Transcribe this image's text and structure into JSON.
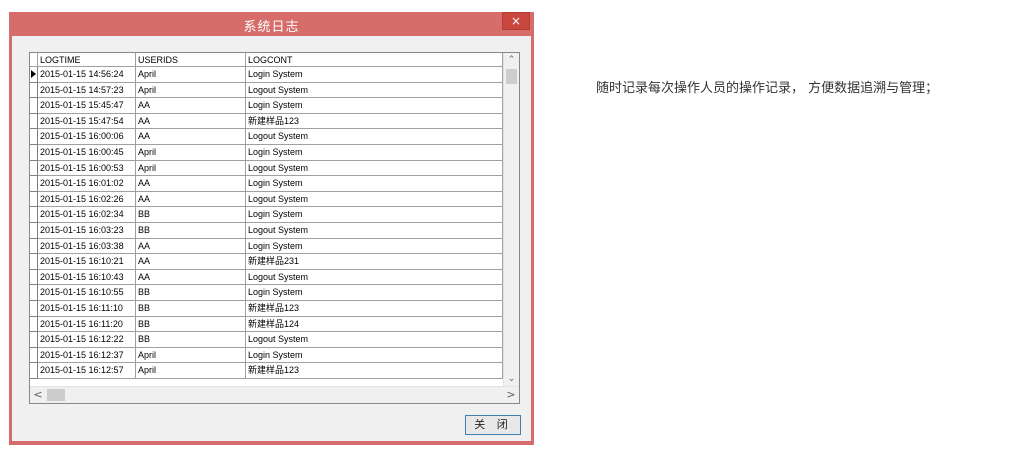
{
  "window": {
    "title": "系统日志",
    "close_glyph": "×",
    "close_button_label": "关 闭"
  },
  "grid": {
    "columns": [
      "LOGTIME",
      "USERIDS",
      "LOGCONT"
    ],
    "rows": [
      [
        "2015-01-15 14:56:24",
        "April",
        "Login System"
      ],
      [
        "2015-01-15 14:57:23",
        "April",
        "Logout System"
      ],
      [
        "2015-01-15 15:45:47",
        "AA",
        "Login System"
      ],
      [
        "2015-01-15 15:47:54",
        "AA",
        "新建样品123"
      ],
      [
        "2015-01-15 16:00:06",
        "AA",
        "Logout System"
      ],
      [
        "2015-01-15 16:00:45",
        "April",
        "Login System"
      ],
      [
        "2015-01-15 16:00:53",
        "April",
        "Logout System"
      ],
      [
        "2015-01-15 16:01:02",
        "AA",
        "Login System"
      ],
      [
        "2015-01-15 16:02:26",
        "AA",
        "Logout System"
      ],
      [
        "2015-01-15 16:02:34",
        "BB",
        "Login System"
      ],
      [
        "2015-01-15 16:03:23",
        "BB",
        "Logout System"
      ],
      [
        "2015-01-15 16:03:38",
        "AA",
        "Login System"
      ],
      [
        "2015-01-15 16:10:21",
        "AA",
        "新建样品231"
      ],
      [
        "2015-01-15 16:10:43",
        "AA",
        "Logout System"
      ],
      [
        "2015-01-15 16:10:55",
        "BB",
        "Login System"
      ],
      [
        "2015-01-15 16:11:10",
        "BB",
        "新建样品123"
      ],
      [
        "2015-01-15 16:11:20",
        "BB",
        "新建样品124"
      ],
      [
        "2015-01-15 16:12:22",
        "BB",
        "Logout System"
      ],
      [
        "2015-01-15 16:12:37",
        "April",
        "Login System"
      ],
      [
        "2015-01-15 16:12:57",
        "April",
        "新建样品123"
      ]
    ]
  },
  "scrollbars": {
    "up": "⌃",
    "down": "⌄",
    "left": "<",
    "right": ">"
  },
  "description": "随时记录每次操作人员的操作记录， 方便数据追溯与管理；"
}
